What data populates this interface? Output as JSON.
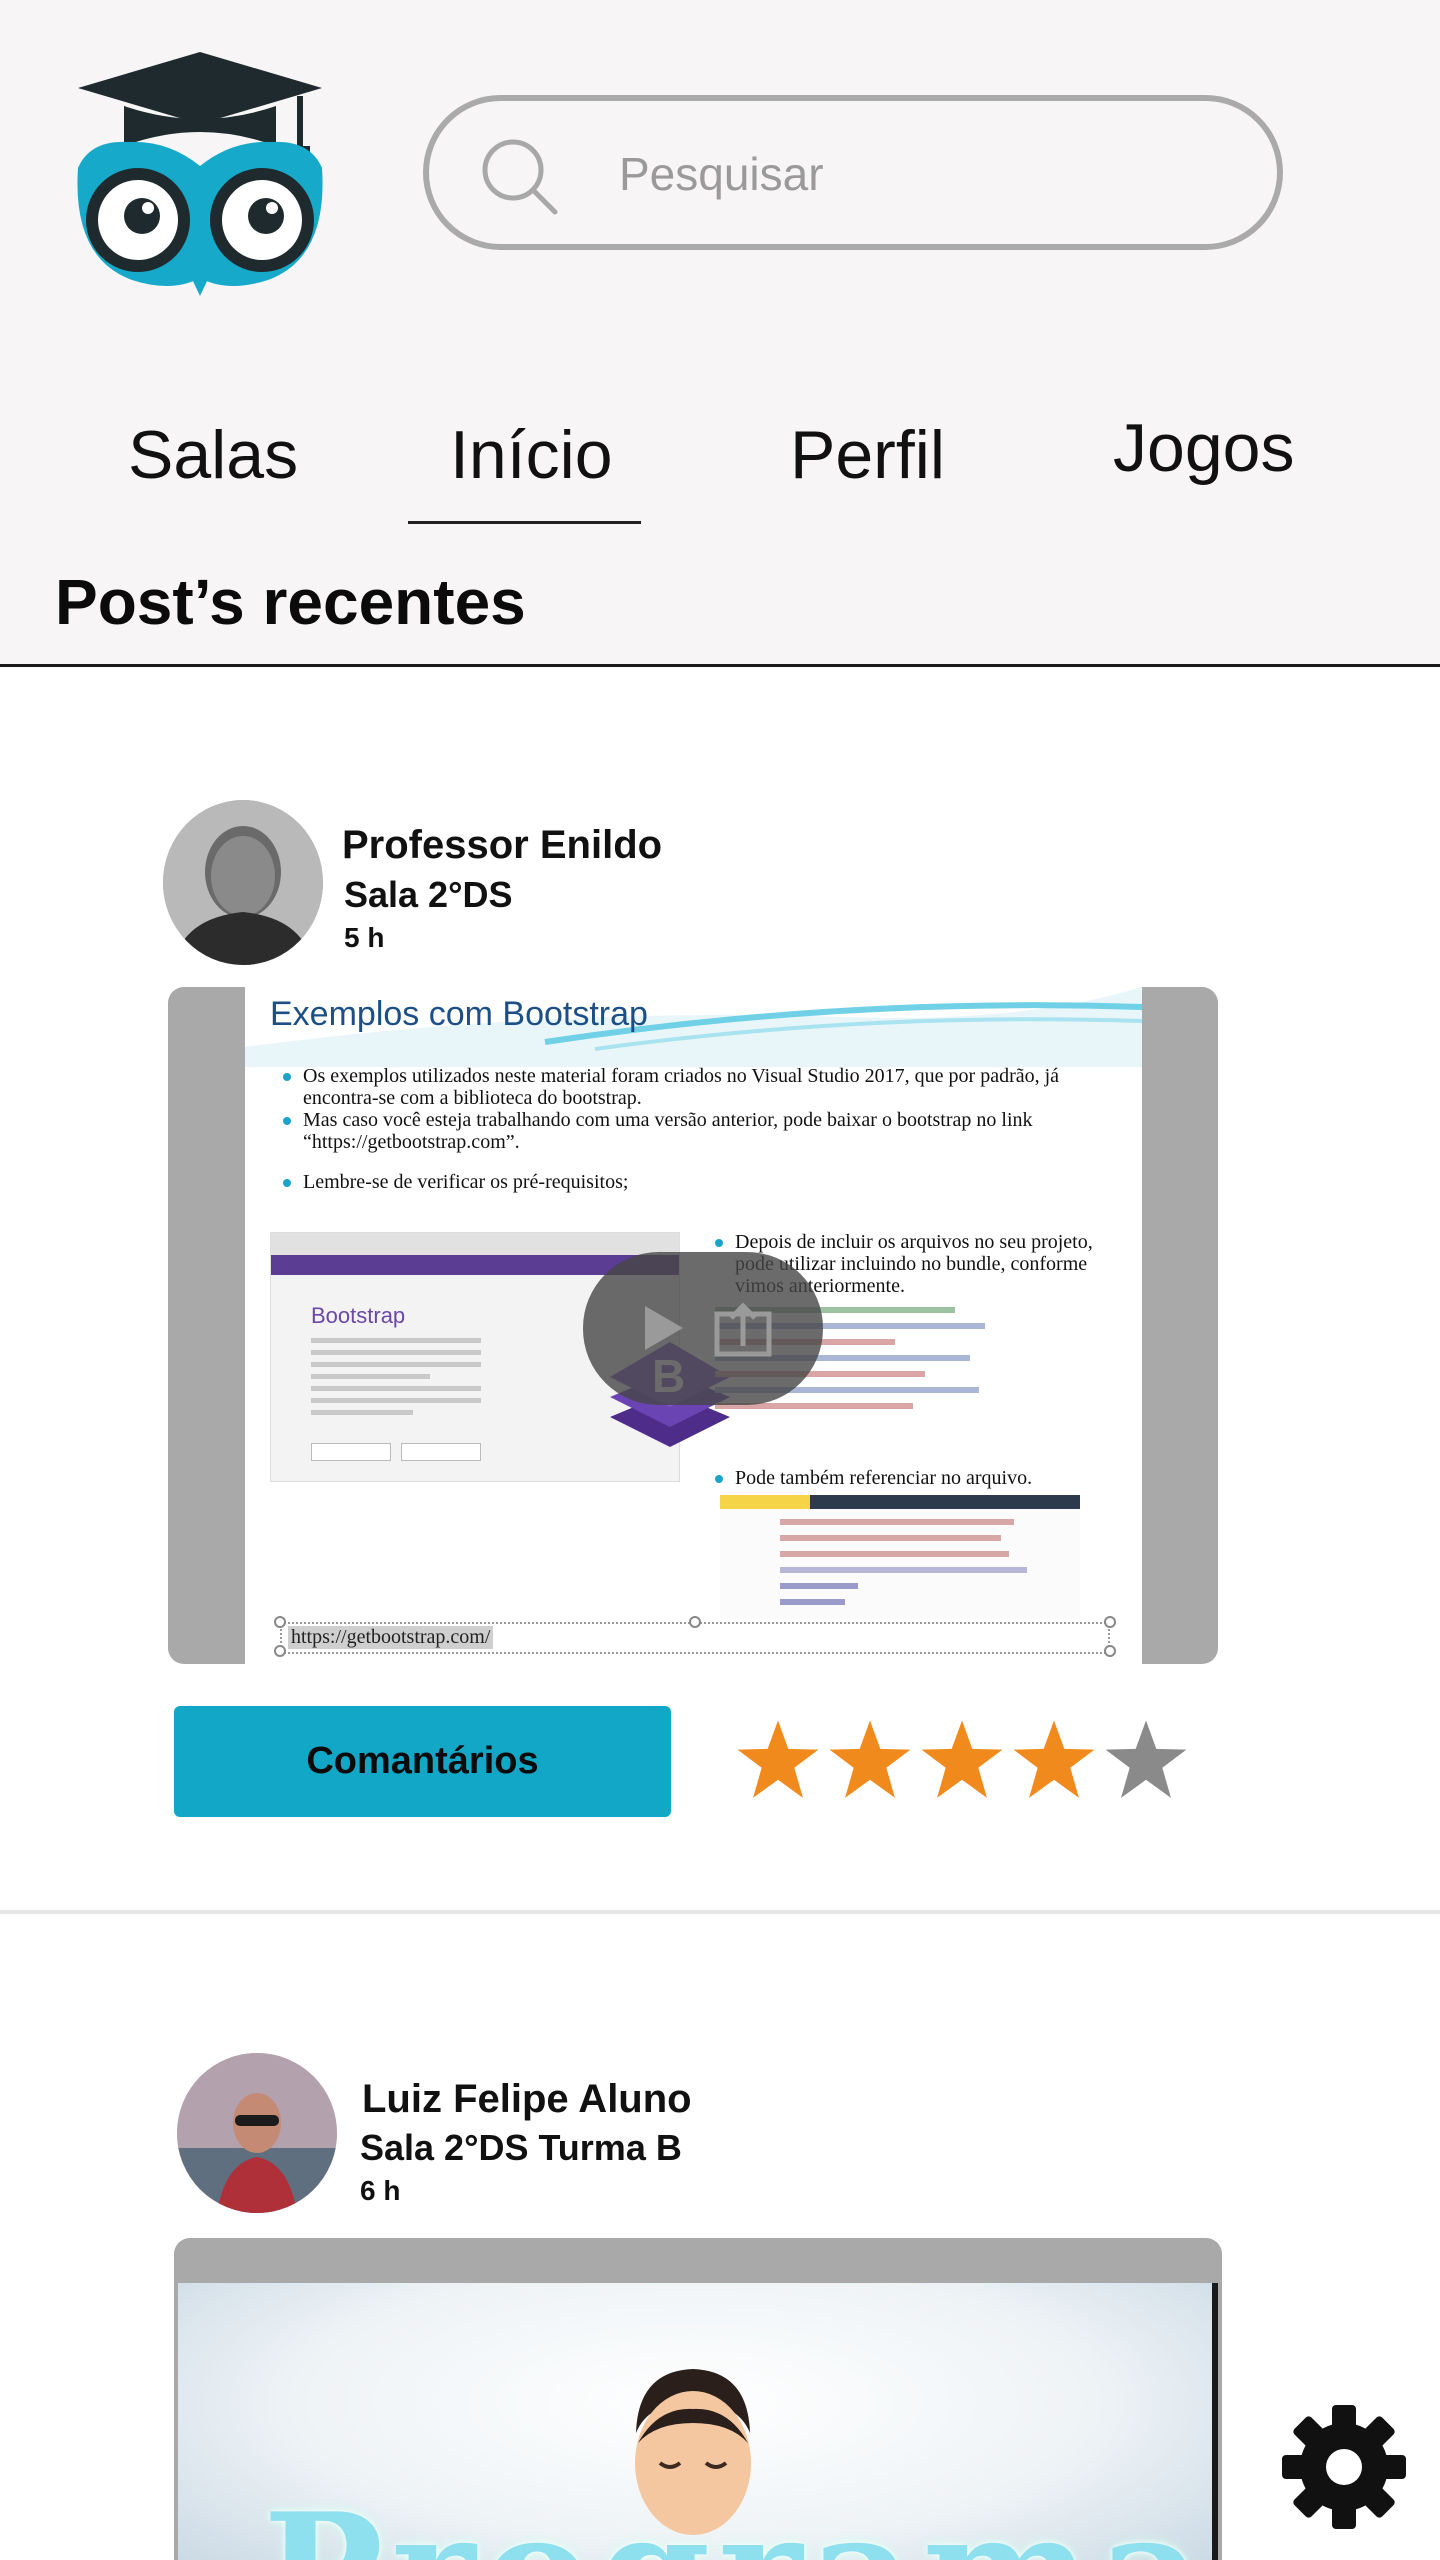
{
  "search": {
    "placeholder": "Pesquisar"
  },
  "tabs": [
    {
      "label": "Salas",
      "active": false
    },
    {
      "label": "Início",
      "active": true
    },
    {
      "label": "Perfil",
      "active": false
    },
    {
      "label": "Jogos",
      "active": false
    }
  ],
  "feed": {
    "title": "Post’s recentes"
  },
  "posts": [
    {
      "author": "Professor Enildo",
      "room": "Sala 2°DS",
      "time": "5 h",
      "slide": {
        "title": "Exemplos com Bootstrap",
        "bullet_1": "Os exemplos utilizados neste material foram criados no Visual Studio 2017, que por padrão, já encontra-se com a biblioteca do bootstrap.",
        "bullet_2": "Mas caso você esteja trabalhando com uma versão anterior, pode baixar o bootstrap no link “https://getbootstrap.com”.",
        "bullet_3": "Lembre-se de verificar os pré-requisitos;",
        "bullet_4": "Depois de incluir os arquivos no seu projeto, pode utilizar incluindo no bundle, conforme vimos anteriormente.",
        "bullet_5": "Pode também referenciar no arquivo.",
        "screenshot_title": "Bootstrap",
        "url": "https://getbootstrap.com/"
      },
      "comment_label": "Comantários",
      "rating": 4,
      "rating_max": 5
    },
    {
      "author": "Luiz Felipe Aluno",
      "room": "Sala 2°DS Turma B",
      "time": "6 h",
      "thumbnail_text": "Programar"
    }
  ],
  "colors": {
    "accent": "#12a7c6",
    "star_filled": "#f08a1c",
    "star_empty": "#8a8a8a",
    "owl_blue": "#16a9c9"
  },
  "icons": {
    "search": "search-icon",
    "settings": "gear-icon",
    "play": "play-icon",
    "share": "share-icon",
    "star": "star-icon"
  }
}
